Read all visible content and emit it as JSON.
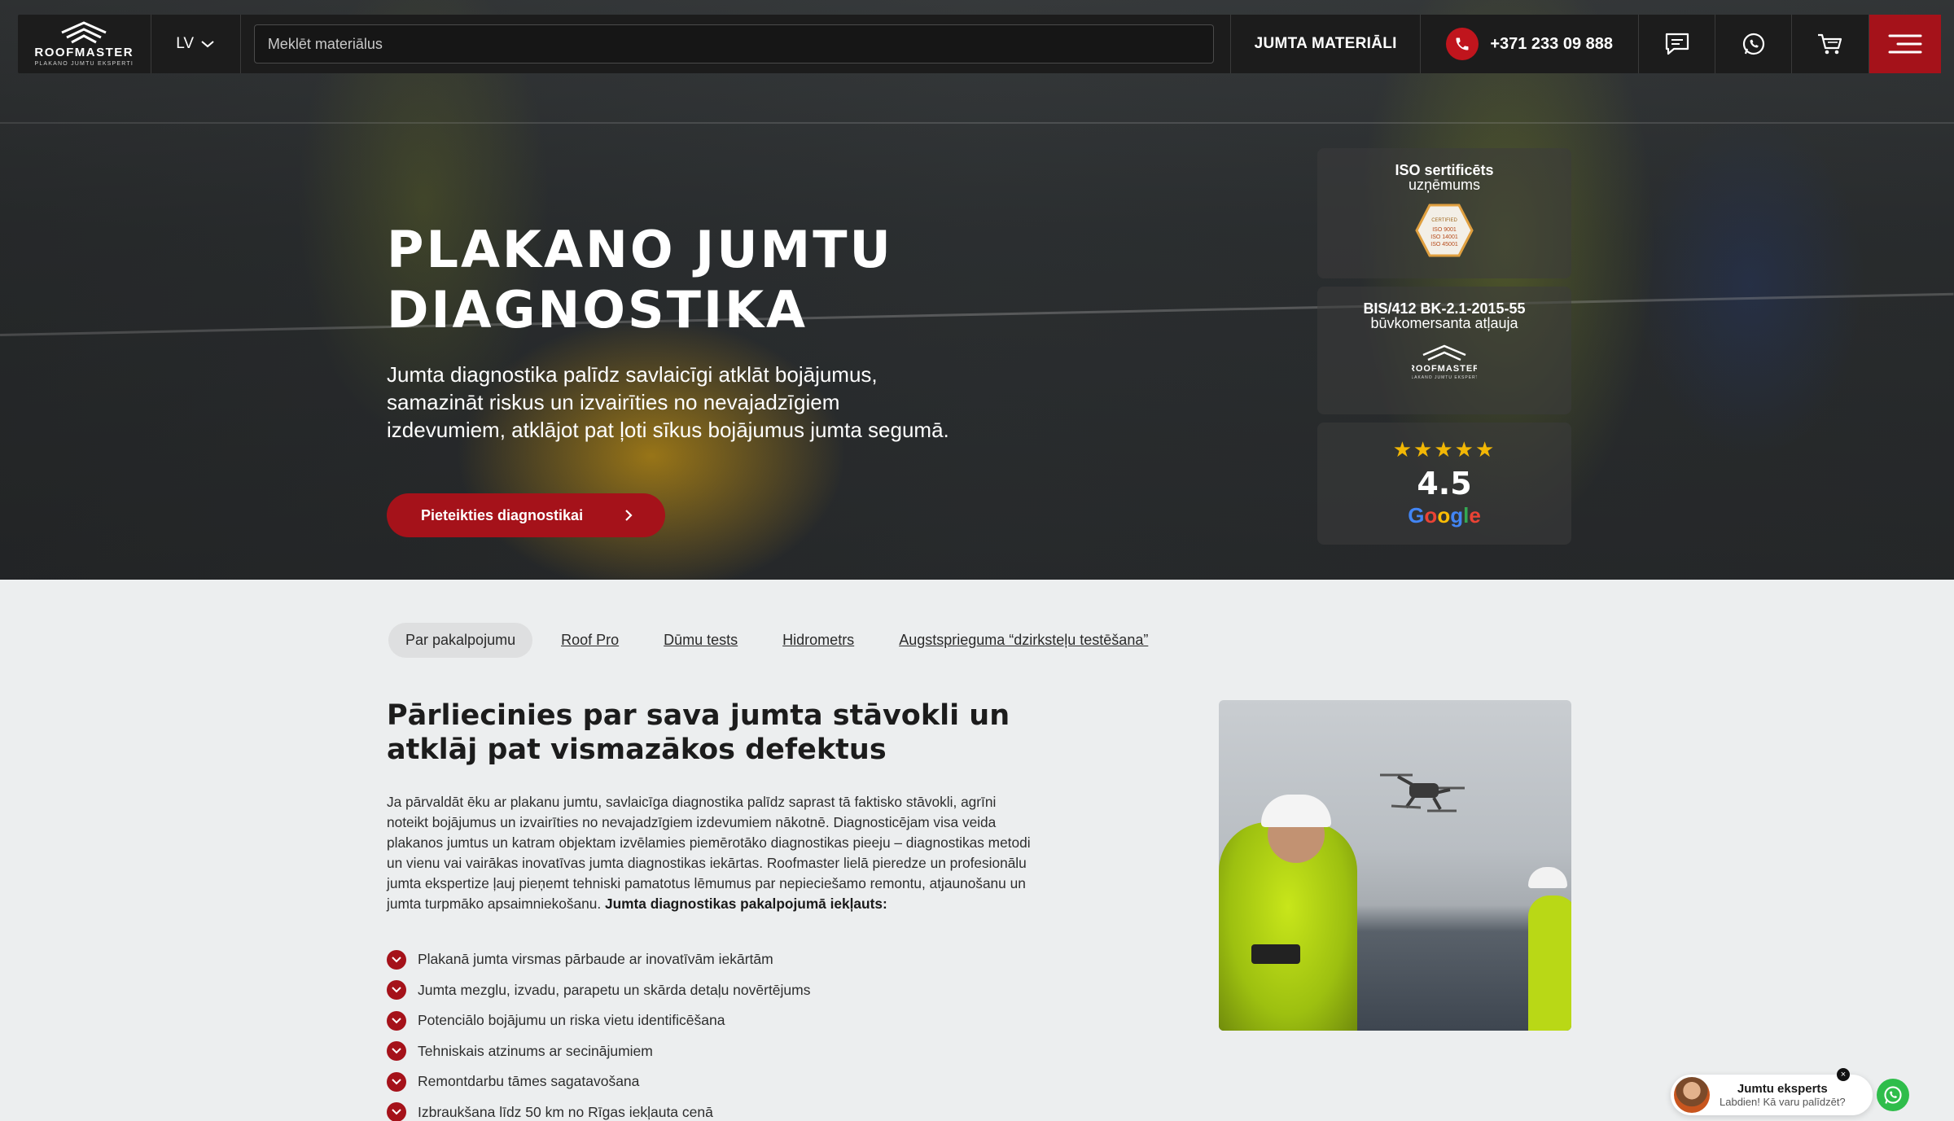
{
  "nav": {
    "logo_name": "ROOFMASTER",
    "logo_sub": "PLAKANO JUMTU EKSPERTI",
    "language": "LV",
    "search_placeholder": "Meklēt materiālus",
    "materials_label": "JUMTA MATERIĀLI",
    "phone": "+371 233 09 888",
    "icons": [
      "chat-icon",
      "whatsapp-icon",
      "cart-icon",
      "hamburger-menu-icon"
    ],
    "accent_color": "#a5121a"
  },
  "hero": {
    "title_line1": "PLAKANO JUMTU",
    "title_line2": "DIAGNOSTIKA",
    "description": "Jumta diagnostika palīdz savlaicīgi atklāt bojājumus, samazināt riskus un izvairīties no nevajadzīgiem izdevumiem, atklājot pat ļoti sīkus bojājumus jumta segumā.",
    "cta_label": "Pieteikties diagnostikai"
  },
  "badges": {
    "iso_title": "ISO sertificēts",
    "iso_sub": "uzņēmums",
    "iso_seal": [
      "CERTIFIED",
      "ISO 9001",
      "ISO 14001",
      "ISO 45001"
    ],
    "permit_title": "BIS/412 BK-2.1-2015-55",
    "permit_sub": "būvkomersanta atļauja",
    "rating_stars": 5,
    "rating": "4.5",
    "rating_source": "Google"
  },
  "tabs": [
    {
      "label": "Par pakalpojumu",
      "active": true
    },
    {
      "label": "Roof Pro",
      "active": false
    },
    {
      "label": "Dūmu tests",
      "active": false
    },
    {
      "label": "Hidrometrs",
      "active": false
    },
    {
      "label": "Augstsprieguma “dzirksteļu testēšana”",
      "active": false
    }
  ],
  "content": {
    "heading": "Pārliecinies par sava jumta stāvokli un atklāj pat vismazākos defektus",
    "paragraph": "Ja pārvaldāt ēku ar plakanu jumtu, savlaicīga diagnostika palīdz saprast tā faktisko stāvokli, agrīni noteikt bojājumus un izvairīties no nevajadzīgiem izdevumiem nākotnē. Diagnosticējam visa veida plakanos jumtus un katram objektam izvēlamies piemērotāko diagnostikas pieeju – diagnostikas metodi un vienu vai vairākas inovatīvas jumta diagnostikas iekārtas. Roofmaster lielā pieredze un profesionālu jumta ekspertize ļauj pieņemt tehniski pamatotus lēmumus par nepieciešamo remontu, atjaunošanu un jumta turpmāko apsaimniekošanu.",
    "paragraph_bold": "Jumta diagnostikas pakalpojumā iekļauts:",
    "list": [
      "Plakanā jumta virsmas pārbaude ar inovatīvām iekārtām",
      "Jumta mezglu, izvadu, parapetu un skārda detaļu novērtējums",
      "Potenciālo bojājumu un riska vietu identificēšana",
      "Tehniskais atzinums ar secinājumiem",
      "Remontdarbu tāmes sagatavošana",
      "Izbraukšana līdz 50 km no Rīgas iekļauta cenā"
    ]
  },
  "chat": {
    "title": "Jumtu eksperts",
    "subtitle": "Labdien! Kā varu palīdzēt?",
    "close": "×"
  }
}
